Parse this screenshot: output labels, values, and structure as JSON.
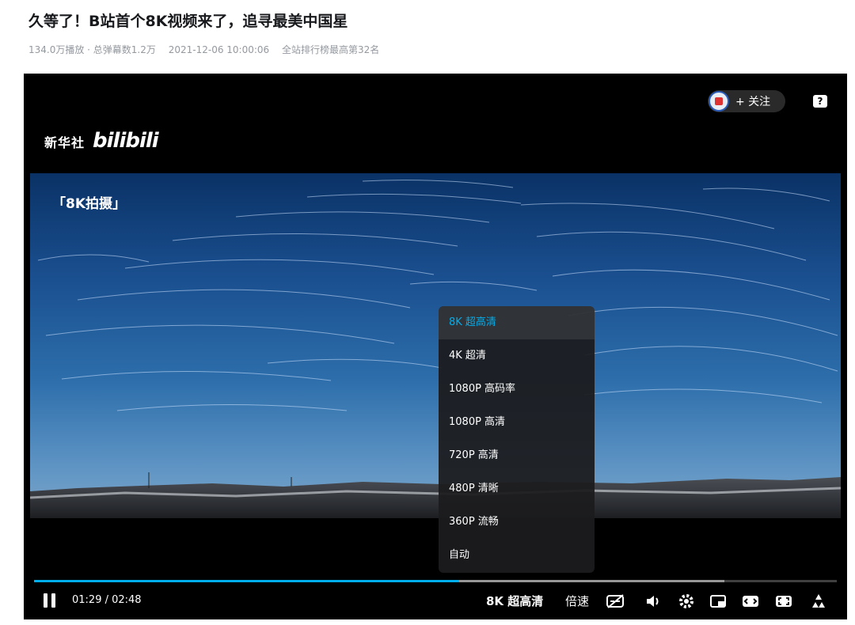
{
  "video": {
    "title": "久等了！B站首个8K视频来了，追寻最美中国星",
    "stats": {
      "views": "134.0万播放 · 总弹幕数1.2万",
      "date": "2021-12-06 10:00:06",
      "rank": "全站排行榜最高第32名"
    }
  },
  "player": {
    "logo": {
      "xinhua": "新华社",
      "bilibili": "bilibili"
    },
    "caption": "「8K拍摄」",
    "follow_label": "+ 关注",
    "help_label": "?",
    "quality_menu": [
      {
        "label": "8K 超高清",
        "active": true
      },
      {
        "label": "4K 超清",
        "active": false
      },
      {
        "label": "1080P 高码率",
        "active": false
      },
      {
        "label": "1080P 高清",
        "active": false
      },
      {
        "label": "720P 高清",
        "active": false
      },
      {
        "label": "480P 清晰",
        "active": false
      },
      {
        "label": "360P 流畅",
        "active": false
      },
      {
        "label": "自动",
        "active": false
      }
    ],
    "time_display": "01:29 / 02:48",
    "progress": 0.53,
    "buffered": 0.86,
    "quality_button": "8K 超高清",
    "speed_button": "倍速",
    "accent_color": "#00aeec",
    "icons": [
      "pause-icon",
      "subtitle-icon",
      "volume-icon",
      "settings-icon",
      "pip-icon",
      "widescreen-icon",
      "web-fullscreen-icon",
      "fullscreen-icon"
    ]
  }
}
